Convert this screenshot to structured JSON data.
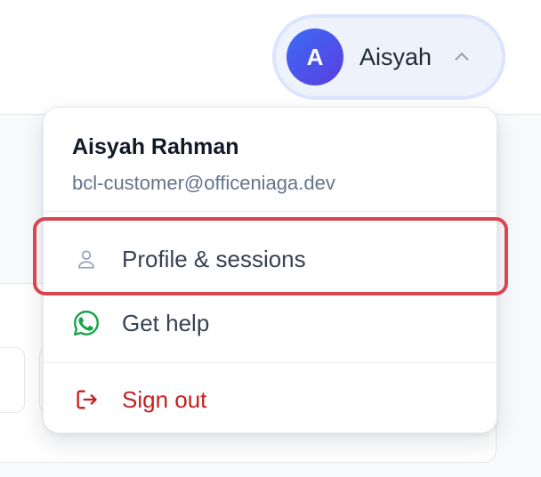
{
  "user_menu": {
    "avatar_initial": "A",
    "display_name": "Aisyah",
    "chevron_icon": "chevron-up-icon"
  },
  "dropdown": {
    "full_name": "Aisyah Rahman",
    "email": "bcl-customer@officeniaga.dev",
    "items": [
      {
        "label": "Profile & sessions",
        "icon": "user-icon",
        "highlighted": true
      },
      {
        "label": "Get help",
        "icon": "whatsapp-icon"
      },
      {
        "label": "Sign out",
        "icon": "sign-out-icon",
        "color": "#c81e1e"
      }
    ]
  },
  "colors": {
    "avatar_gradient_start": "#3b6cf6",
    "avatar_gradient_end": "#5b3de0",
    "highlight_border": "#d94452",
    "whatsapp_green": "#16a34a",
    "danger_red": "#c81e1e"
  }
}
